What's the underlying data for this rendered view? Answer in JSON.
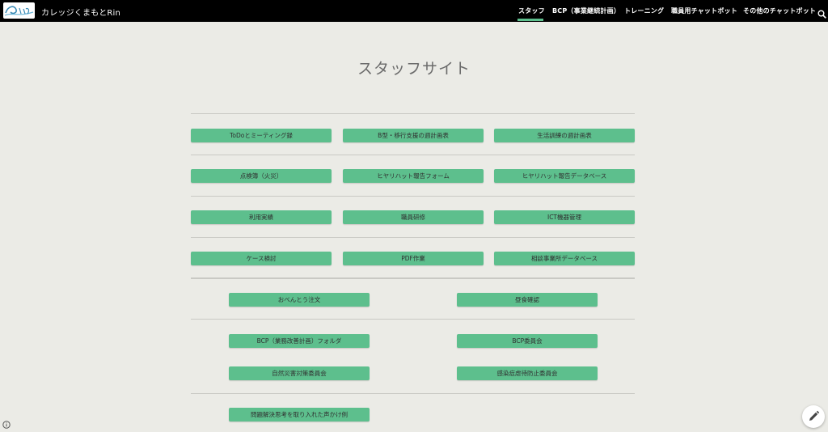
{
  "header": {
    "site_title": "カレッジくまもとRin",
    "nav": [
      {
        "label": "スタッフ"
      },
      {
        "label": "BCP（事業継続計画）"
      },
      {
        "label": "トレーニング"
      },
      {
        "label": "職員用チャットボット"
      },
      {
        "label": "その他のチャットボット"
      }
    ],
    "search_icon": "search-icon"
  },
  "main": {
    "title": "スタッフサイト",
    "rows": [
      [
        "ToDoとミーティング録",
        "B型・移行支援の週計画表",
        "生活訓練の週計画表"
      ],
      [
        "点検簿（火災）",
        "ヒヤリハット報告フォーム",
        "ヒヤリハット報告データベース"
      ],
      [
        "利用実績",
        "職員研修",
        "ICT機器管理"
      ],
      [
        "ケース検討",
        "PDF作業",
        "相談事業所データベース"
      ],
      [
        "おべんとう注文",
        "昼食確認"
      ],
      [
        "BCP（業務改善計画）フォルダ",
        "BCP委員会"
      ],
      [
        "自然災害対策委員会",
        "感染症虐待防止委員会"
      ],
      [
        "問題解決思考を取り入れた声かけ例"
      ]
    ]
  },
  "colors": {
    "accent": "#5dbf8d",
    "header_bg": "#000000",
    "page_bg": "#ebebe6"
  },
  "icons": {
    "info": "info-icon",
    "edit": "pencil-icon"
  }
}
